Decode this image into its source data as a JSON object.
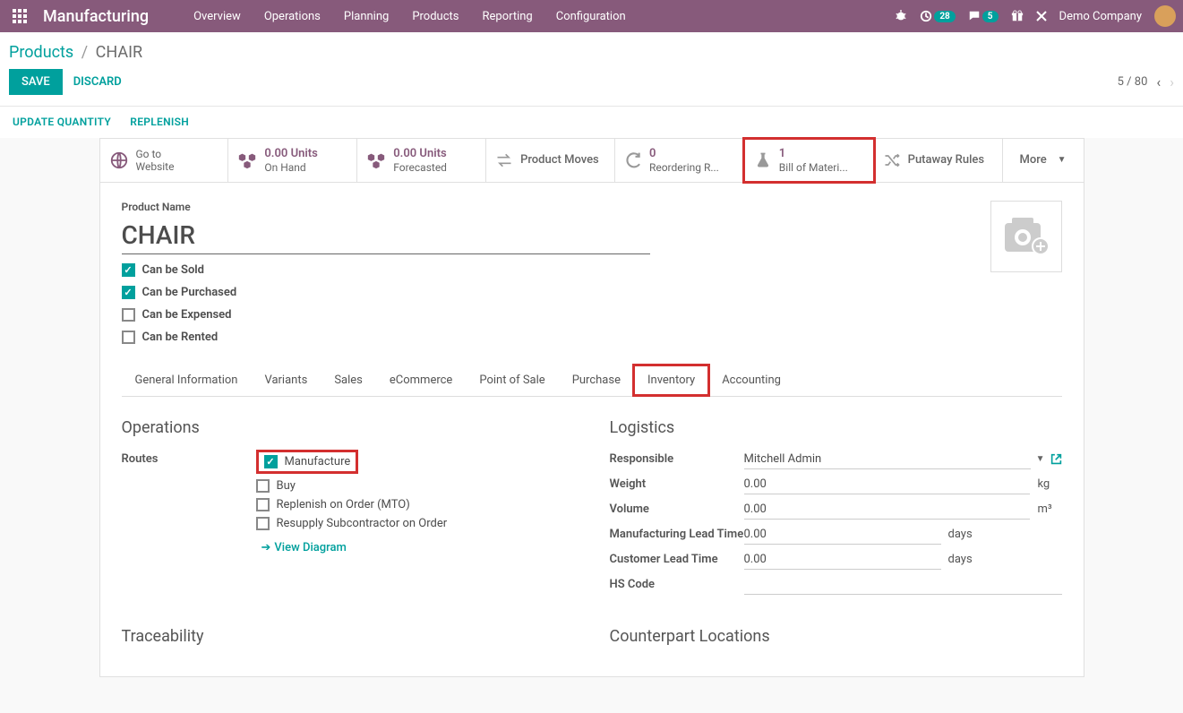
{
  "topbar": {
    "app_title": "Manufacturing",
    "nav": [
      "Overview",
      "Operations",
      "Planning",
      "Products",
      "Reporting",
      "Configuration"
    ],
    "clock_badge": "28",
    "chat_badge": "5",
    "company": "Demo Company"
  },
  "breadcrumb": {
    "parent": "Products",
    "current": "CHAIR"
  },
  "actions": {
    "save": "SAVE",
    "discard": "DISCARD",
    "pager": "5 / 80",
    "update_quantity": "UPDATE QUANTITY",
    "replenish": "REPLENISH"
  },
  "stat_buttons": {
    "website": {
      "line1": "Go to",
      "line2": "Website"
    },
    "on_hand": {
      "value": "0.00 Units",
      "label": "On Hand"
    },
    "forecasted": {
      "value": "0.00 Units",
      "label": "Forecasted"
    },
    "moves": "Product Moves",
    "reordering": {
      "value": "0",
      "label": "Reordering R..."
    },
    "bom": {
      "value": "1",
      "label": "Bill of Materi..."
    },
    "putaway": "Putaway Rules",
    "more": "More"
  },
  "form": {
    "product_name_label": "Product Name",
    "product_name": "CHAIR",
    "can_be_sold": "Can be Sold",
    "can_be_purchased": "Can be Purchased",
    "can_be_expensed": "Can be Expensed",
    "can_be_rented": "Can be Rented"
  },
  "tabs": [
    "General Information",
    "Variants",
    "Sales",
    "eCommerce",
    "Point of Sale",
    "Purchase",
    "Inventory",
    "Accounting"
  ],
  "inventory": {
    "operations_title": "Operations",
    "routes_label": "Routes",
    "routes": {
      "manufacture": "Manufacture",
      "buy": "Buy",
      "mto": "Replenish on Order (MTO)",
      "resupply": "Resupply Subcontractor on Order"
    },
    "view_diagram": "View Diagram",
    "logistics_title": "Logistics",
    "responsible_label": "Responsible",
    "responsible_value": "Mitchell Admin",
    "weight_label": "Weight",
    "weight_value": "0.00",
    "weight_unit": "kg",
    "volume_label": "Volume",
    "volume_value": "0.00",
    "volume_unit": "m³",
    "mfg_lead_label": "Manufacturing Lead Time",
    "mfg_lead_value": "0.00",
    "mfg_lead_unit": "days",
    "cust_lead_label": "Customer Lead Time",
    "cust_lead_value": "0.00",
    "cust_lead_unit": "days",
    "hs_label": "HS Code",
    "traceability_title": "Traceability",
    "counterpart_title": "Counterpart Locations"
  }
}
